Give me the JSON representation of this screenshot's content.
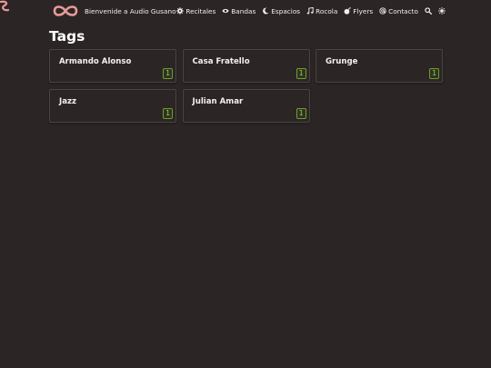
{
  "header": {
    "site_title": "Bienvenide a Audio Gusano",
    "logo_icon": "infinity-worm-icon",
    "brand_color": "#e89a9a",
    "nav": [
      {
        "label": "Recitales",
        "icon": "gear-icon"
      },
      {
        "label": "Bandas",
        "icon": "eye-icon"
      },
      {
        "label": "Espacios",
        "icon": "moon-icon"
      },
      {
        "label": "Rocola",
        "icon": "music-note-icon"
      },
      {
        "label": "Flyers",
        "icon": "bomb-icon"
      },
      {
        "label": "Contacto",
        "icon": "at-sign-icon"
      }
    ],
    "search_icon": "search-icon",
    "theme_icon": "sun-icon"
  },
  "page": {
    "title": "Tags"
  },
  "tags": [
    {
      "name": "Armando Alonso",
      "count": "1"
    },
    {
      "name": "Casa Fratello",
      "count": "1"
    },
    {
      "name": "Grunge",
      "count": "1"
    },
    {
      "name": "Jazz",
      "count": "1"
    },
    {
      "name": "Julian Amar",
      "count": "1"
    }
  ],
  "colors": {
    "background": "#2b2625",
    "card_border": "#4a4443",
    "count_border": "#6f9b2f",
    "count_text": "#9fd04a"
  }
}
